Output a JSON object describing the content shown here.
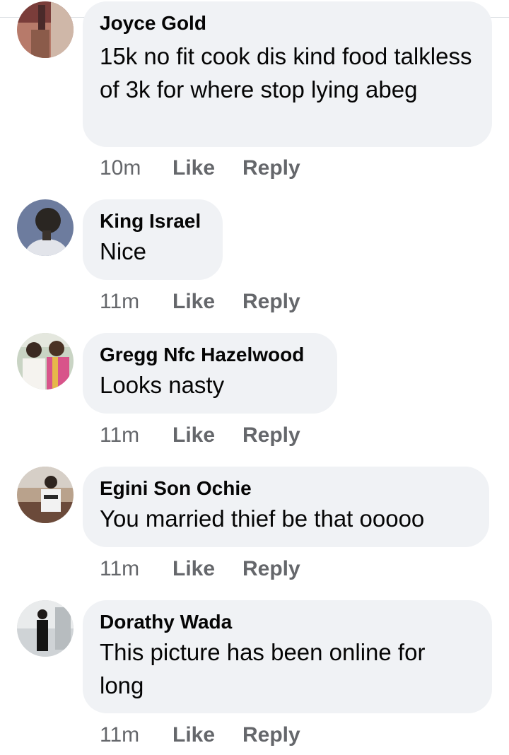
{
  "comments": [
    {
      "author": "Joyce Gold",
      "text": "15k no fit cook dis kind food talkless of 3k for where stop lying abeg",
      "time": "10m",
      "like_label": "Like",
      "reply_label": "Reply",
      "avatar_icon": "user-avatar"
    },
    {
      "author": "King Israel",
      "text": "Nice",
      "time": "11m",
      "like_label": "Like",
      "reply_label": "Reply",
      "avatar_icon": "user-avatar"
    },
    {
      "author": "Gregg Nfc Hazelwood",
      "text": "Looks nasty",
      "time": "11m",
      "like_label": "Like",
      "reply_label": "Reply",
      "avatar_icon": "user-avatar"
    },
    {
      "author": "Egini Son Ochie",
      "text": "You married thief be that ooooo",
      "time": "11m",
      "like_label": "Like",
      "reply_label": "Reply",
      "avatar_icon": "user-avatar"
    },
    {
      "author": "Dorathy Wada",
      "text": "This picture has been online for long",
      "time": "11m",
      "like_label": "Like",
      "reply_label": "Reply",
      "avatar_icon": "user-avatar"
    }
  ],
  "colors": {
    "bubble": "#f0f2f5",
    "meta": "#65676b",
    "text": "#050505"
  }
}
